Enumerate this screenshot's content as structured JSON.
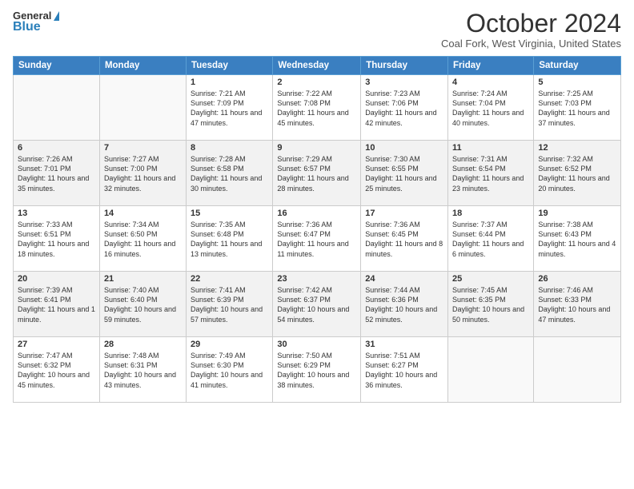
{
  "logo": {
    "general": "General",
    "blue": "Blue"
  },
  "header": {
    "month": "October 2024",
    "location": "Coal Fork, West Virginia, United States"
  },
  "weekdays": [
    "Sunday",
    "Monday",
    "Tuesday",
    "Wednesday",
    "Thursday",
    "Friday",
    "Saturday"
  ],
  "weeks": [
    [
      {
        "day": null
      },
      {
        "day": null
      },
      {
        "day": "1",
        "sunrise": "Sunrise: 7:21 AM",
        "sunset": "Sunset: 7:09 PM",
        "daylight": "Daylight: 11 hours and 47 minutes."
      },
      {
        "day": "2",
        "sunrise": "Sunrise: 7:22 AM",
        "sunset": "Sunset: 7:08 PM",
        "daylight": "Daylight: 11 hours and 45 minutes."
      },
      {
        "day": "3",
        "sunrise": "Sunrise: 7:23 AM",
        "sunset": "Sunset: 7:06 PM",
        "daylight": "Daylight: 11 hours and 42 minutes."
      },
      {
        "day": "4",
        "sunrise": "Sunrise: 7:24 AM",
        "sunset": "Sunset: 7:04 PM",
        "daylight": "Daylight: 11 hours and 40 minutes."
      },
      {
        "day": "5",
        "sunrise": "Sunrise: 7:25 AM",
        "sunset": "Sunset: 7:03 PM",
        "daylight": "Daylight: 11 hours and 37 minutes."
      }
    ],
    [
      {
        "day": "6",
        "sunrise": "Sunrise: 7:26 AM",
        "sunset": "Sunset: 7:01 PM",
        "daylight": "Daylight: 11 hours and 35 minutes."
      },
      {
        "day": "7",
        "sunrise": "Sunrise: 7:27 AM",
        "sunset": "Sunset: 7:00 PM",
        "daylight": "Daylight: 11 hours and 32 minutes."
      },
      {
        "day": "8",
        "sunrise": "Sunrise: 7:28 AM",
        "sunset": "Sunset: 6:58 PM",
        "daylight": "Daylight: 11 hours and 30 minutes."
      },
      {
        "day": "9",
        "sunrise": "Sunrise: 7:29 AM",
        "sunset": "Sunset: 6:57 PM",
        "daylight": "Daylight: 11 hours and 28 minutes."
      },
      {
        "day": "10",
        "sunrise": "Sunrise: 7:30 AM",
        "sunset": "Sunset: 6:55 PM",
        "daylight": "Daylight: 11 hours and 25 minutes."
      },
      {
        "day": "11",
        "sunrise": "Sunrise: 7:31 AM",
        "sunset": "Sunset: 6:54 PM",
        "daylight": "Daylight: 11 hours and 23 minutes."
      },
      {
        "day": "12",
        "sunrise": "Sunrise: 7:32 AM",
        "sunset": "Sunset: 6:52 PM",
        "daylight": "Daylight: 11 hours and 20 minutes."
      }
    ],
    [
      {
        "day": "13",
        "sunrise": "Sunrise: 7:33 AM",
        "sunset": "Sunset: 6:51 PM",
        "daylight": "Daylight: 11 hours and 18 minutes."
      },
      {
        "day": "14",
        "sunrise": "Sunrise: 7:34 AM",
        "sunset": "Sunset: 6:50 PM",
        "daylight": "Daylight: 11 hours and 16 minutes."
      },
      {
        "day": "15",
        "sunrise": "Sunrise: 7:35 AM",
        "sunset": "Sunset: 6:48 PM",
        "daylight": "Daylight: 11 hours and 13 minutes."
      },
      {
        "day": "16",
        "sunrise": "Sunrise: 7:36 AM",
        "sunset": "Sunset: 6:47 PM",
        "daylight": "Daylight: 11 hours and 11 minutes."
      },
      {
        "day": "17",
        "sunrise": "Sunrise: 7:36 AM",
        "sunset": "Sunset: 6:45 PM",
        "daylight": "Daylight: 11 hours and 8 minutes."
      },
      {
        "day": "18",
        "sunrise": "Sunrise: 7:37 AM",
        "sunset": "Sunset: 6:44 PM",
        "daylight": "Daylight: 11 hours and 6 minutes."
      },
      {
        "day": "19",
        "sunrise": "Sunrise: 7:38 AM",
        "sunset": "Sunset: 6:43 PM",
        "daylight": "Daylight: 11 hours and 4 minutes."
      }
    ],
    [
      {
        "day": "20",
        "sunrise": "Sunrise: 7:39 AM",
        "sunset": "Sunset: 6:41 PM",
        "daylight": "Daylight: 11 hours and 1 minute."
      },
      {
        "day": "21",
        "sunrise": "Sunrise: 7:40 AM",
        "sunset": "Sunset: 6:40 PM",
        "daylight": "Daylight: 10 hours and 59 minutes."
      },
      {
        "day": "22",
        "sunrise": "Sunrise: 7:41 AM",
        "sunset": "Sunset: 6:39 PM",
        "daylight": "Daylight: 10 hours and 57 minutes."
      },
      {
        "day": "23",
        "sunrise": "Sunrise: 7:42 AM",
        "sunset": "Sunset: 6:37 PM",
        "daylight": "Daylight: 10 hours and 54 minutes."
      },
      {
        "day": "24",
        "sunrise": "Sunrise: 7:44 AM",
        "sunset": "Sunset: 6:36 PM",
        "daylight": "Daylight: 10 hours and 52 minutes."
      },
      {
        "day": "25",
        "sunrise": "Sunrise: 7:45 AM",
        "sunset": "Sunset: 6:35 PM",
        "daylight": "Daylight: 10 hours and 50 minutes."
      },
      {
        "day": "26",
        "sunrise": "Sunrise: 7:46 AM",
        "sunset": "Sunset: 6:33 PM",
        "daylight": "Daylight: 10 hours and 47 minutes."
      }
    ],
    [
      {
        "day": "27",
        "sunrise": "Sunrise: 7:47 AM",
        "sunset": "Sunset: 6:32 PM",
        "daylight": "Daylight: 10 hours and 45 minutes."
      },
      {
        "day": "28",
        "sunrise": "Sunrise: 7:48 AM",
        "sunset": "Sunset: 6:31 PM",
        "daylight": "Daylight: 10 hours and 43 minutes."
      },
      {
        "day": "29",
        "sunrise": "Sunrise: 7:49 AM",
        "sunset": "Sunset: 6:30 PM",
        "daylight": "Daylight: 10 hours and 41 minutes."
      },
      {
        "day": "30",
        "sunrise": "Sunrise: 7:50 AM",
        "sunset": "Sunset: 6:29 PM",
        "daylight": "Daylight: 10 hours and 38 minutes."
      },
      {
        "day": "31",
        "sunrise": "Sunrise: 7:51 AM",
        "sunset": "Sunset: 6:27 PM",
        "daylight": "Daylight: 10 hours and 36 minutes."
      },
      {
        "day": null
      },
      {
        "day": null
      }
    ]
  ]
}
